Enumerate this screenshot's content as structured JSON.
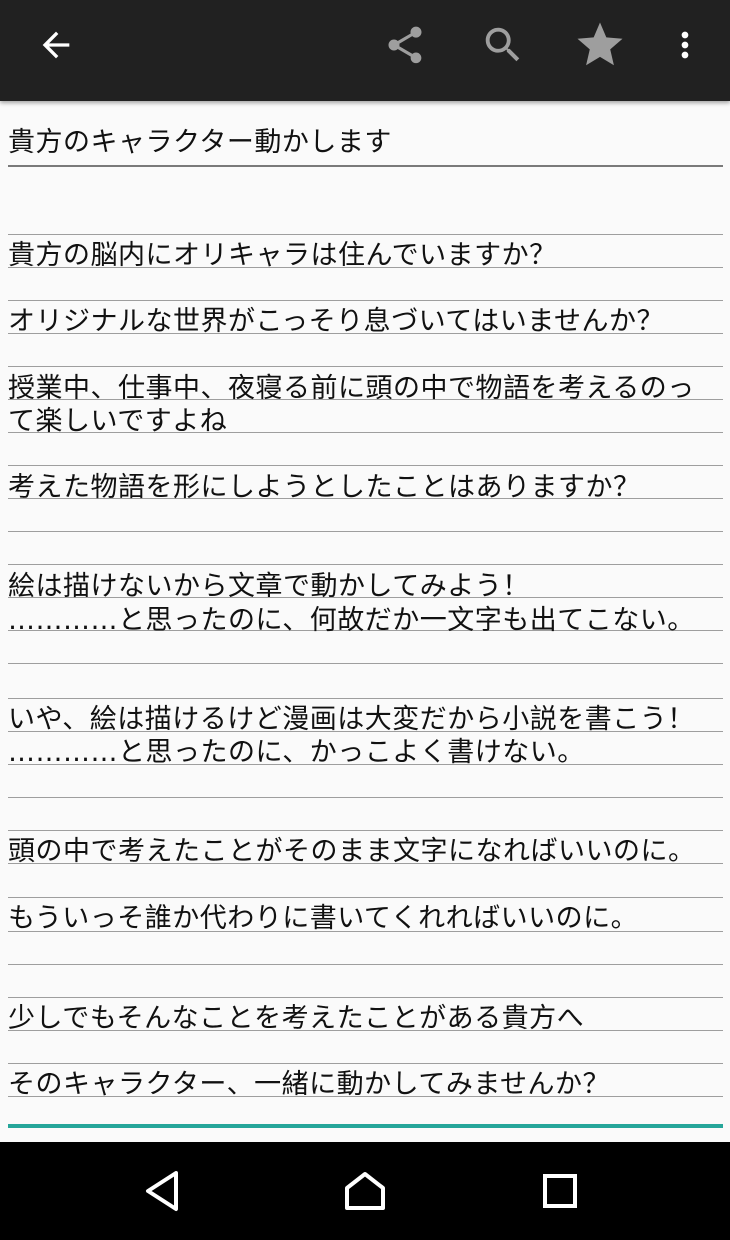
{
  "toolbar": {
    "icons": [
      "arrow-back-icon",
      "share-icon",
      "search-icon",
      "star-icon",
      "more-vert-icon"
    ],
    "colors": {
      "background": "#212121",
      "back_icon": "#ffffff",
      "action_icons": "#9e9e9e",
      "more_icon": "#ffffff"
    }
  },
  "document": {
    "title": "貴方のキャラクター動かします",
    "lines": [
      "",
      "貴方の脳内にオリキャラは住んでいますか？",
      "オリジナルな世界がこっそり息づいてはいませんか？",
      "授業中、仕事中、夜寝る前に頭の中で物語を考えるのっ",
      "て楽しいですよね",
      "考えた物語を形にしようとしたことはありますか？",
      "",
      "絵は描けないから文章で動かしてみよう！",
      "…………と思ったのに、何故だか一文字も出てこない。",
      "",
      "いや、絵は描けるけど漫画は大変だから小説を書こう！",
      "…………と思ったのに、かっこよく書けない。",
      "",
      "頭の中で考えたことがそのまま文字になればいいのに。",
      "もういっそ誰か代わりに書いてくれればいいのに。",
      "",
      "少しでもそんなことを考えたことがある貴方へ",
      "そのキャラクター、一緒に動かしてみませんか？"
    ],
    "colors": {
      "text": "#111111",
      "rule": "#9e9e9e",
      "focus_underline": "#26a69a"
    }
  },
  "navbar": {
    "icons": [
      "nav-back-icon",
      "nav-home-icon",
      "nav-recents-icon"
    ]
  }
}
